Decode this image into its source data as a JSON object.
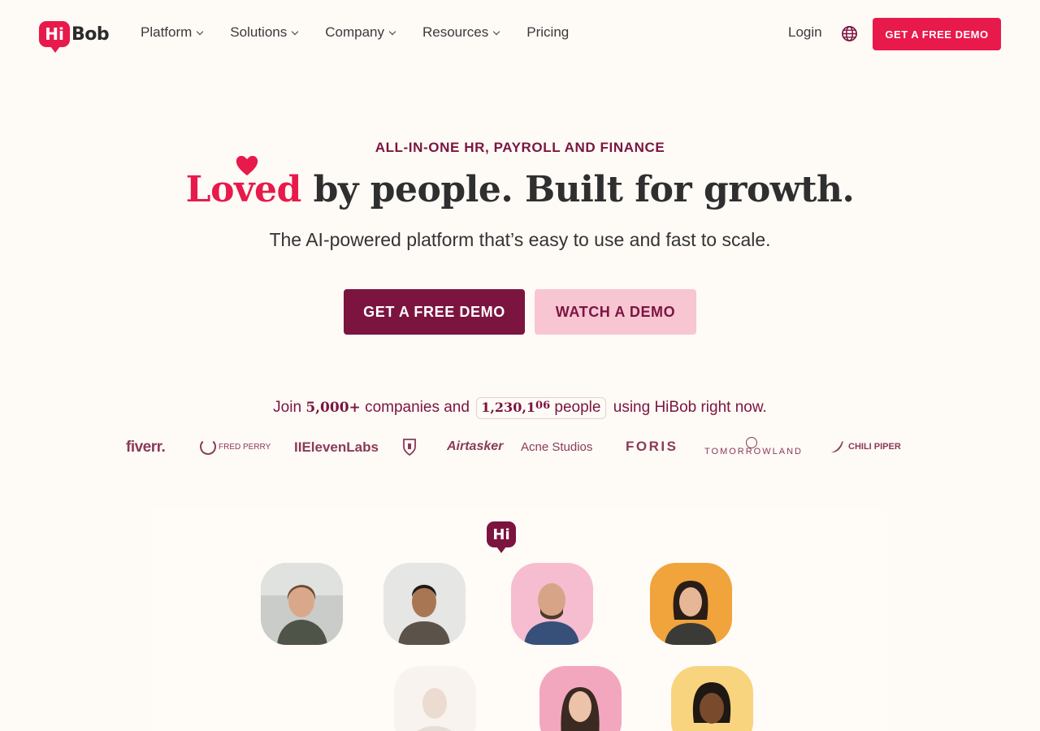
{
  "nav": {
    "logo_hi": "Hi",
    "logo_bob": "Bob",
    "menu": [
      {
        "label": "Platform",
        "has_dropdown": true
      },
      {
        "label": "Solutions",
        "has_dropdown": true
      },
      {
        "label": "Company",
        "has_dropdown": true
      },
      {
        "label": "Resources",
        "has_dropdown": true
      },
      {
        "label": "Pricing",
        "has_dropdown": false
      }
    ],
    "login": "Login",
    "globe_icon": "globe-icon",
    "cta": "GET A FREE DEMO"
  },
  "hero": {
    "eyebrow": "ALL-IN-ONE HR, PAYROLL AND FINANCE",
    "headline_accent": "Loved",
    "headline_rest": " by people. Built for growth.",
    "subhead": "The AI-powered platform that’s easy to use and fast to scale.",
    "primary_button": "GET A FREE DEMO",
    "secondary_button": "WATCH A DEMO"
  },
  "social_proof": {
    "prefix": "Join ",
    "companies": "5,000+",
    "middle": " companies and ",
    "people_count": "1,230,1",
    "people_count_rolling": "06",
    "people_label": "people",
    "suffix": " using HiBob right now."
  },
  "customer_logos": [
    "fiverr.",
    "FRED PERRY",
    "IIElevenLabs",
    "fulham-crest",
    "Airtasker",
    "Acne Studios",
    "FORIS",
    "TOMORROWLAND",
    "CHILI PIPER"
  ],
  "people_panel": {
    "badge": "Hi"
  },
  "colors": {
    "background": "#fefaf6",
    "brand_pink": "#e8194b",
    "brand_wine": "#7c1440",
    "soft_pink": "#f8c6d3"
  }
}
